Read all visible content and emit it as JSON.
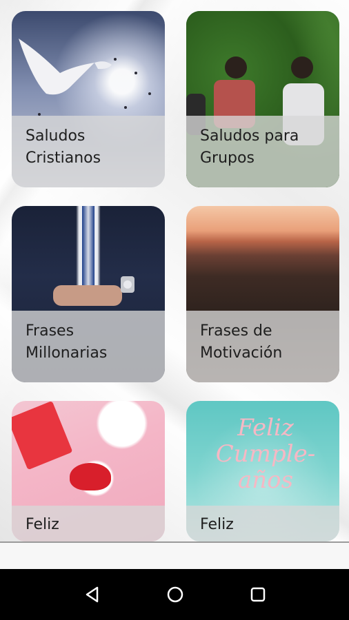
{
  "cards": [
    {
      "line1": "Saludos",
      "line2": "Cristianos",
      "image": "doves-image"
    },
    {
      "line1": "Saludos para",
      "line2": "Grupos",
      "image": "friends-hill-image"
    },
    {
      "line1": "Frases",
      "line2": "Millonarias",
      "image": "suit-image"
    },
    {
      "line1": "Frases de",
      "line2": "Motivación",
      "image": "sunset-image"
    },
    {
      "line1": "Feliz",
      "line2": "",
      "image": "gifts-image"
    },
    {
      "line1": "Feliz",
      "line2": "",
      "image": "birthday-image",
      "script_text": "Feliz Cumple-años"
    }
  ],
  "navbar": {
    "back_icon": "triangle-back-icon",
    "home_icon": "circle-home-icon",
    "recent_icon": "square-recents-icon"
  },
  "colors": {
    "caption_bg": "#d7d7d7",
    "text": "#1e1e1e",
    "navbar": "#000000",
    "nav_icon": "#ffffff"
  }
}
